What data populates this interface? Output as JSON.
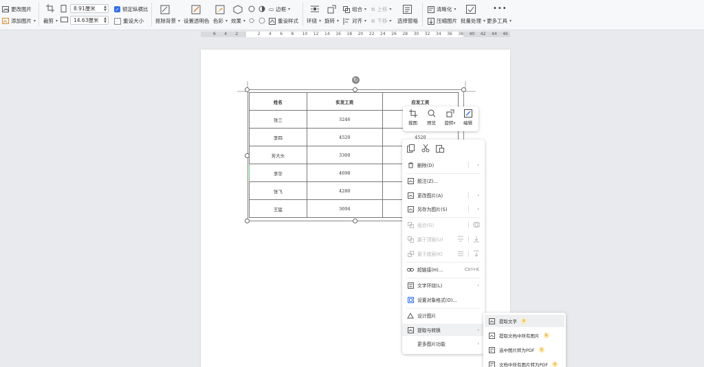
{
  "toolbar": {
    "change_picture": "更改图片",
    "add_picture": "添加图片",
    "crop": "裁剪",
    "height_value": "8.91厘米",
    "width_value": "14.63厘米",
    "lock_ratio": "锁定纵横比",
    "reset_size": "重设大小",
    "remove_bg": "抠除背景",
    "set_transparent": "设置透明色",
    "color": "色彩",
    "effects": "效果",
    "border": "边框",
    "reset_style": "重设样式",
    "wrap": "环绕",
    "rotate": "旋转",
    "group": "组合",
    "align": "对齐",
    "bring_forward": "上移",
    "send_backward": "下移",
    "selection_pane": "选择窗格",
    "clarity": "清晰化",
    "compress": "压缩图片",
    "batch": "批量处理",
    "more_tools": "更多工具"
  },
  "ruler": {
    "ticks": [
      "6",
      "4",
      "2",
      "",
      "2",
      "4",
      "6",
      "8",
      "10",
      "12",
      "14",
      "16",
      "18",
      "20",
      "22",
      "24",
      "26",
      "28",
      "30",
      "32",
      "34",
      "36",
      "38",
      "40",
      "42",
      "44",
      "46"
    ]
  },
  "table": {
    "headers": [
      "姓名",
      "实发工资",
      "应发工资"
    ],
    "rows": [
      [
        "张三",
        "3246",
        ""
      ],
      [
        "李四",
        "4520",
        "4520"
      ],
      [
        "芳大头",
        "3300",
        ""
      ],
      [
        "李华",
        "4698",
        ""
      ],
      [
        "张飞",
        "4280",
        ""
      ],
      [
        "王猛",
        "3694",
        ""
      ]
    ]
  },
  "mini_toolbar": {
    "crop": "裁图",
    "preview": "预览",
    "rotate": "旋转",
    "edit": "编辑"
  },
  "context_menu": {
    "delete": "删除(D)",
    "caption": "题注(Z)...",
    "change_picture": "更改图片(A)",
    "save_as_picture": "另存为图片(S)",
    "group": "组合(G)",
    "bring_to_front": "置于顶层(U)",
    "send_to_back": "置于底层(K)",
    "hyperlink": "超链接(H)...",
    "hyperlink_shortcut": "Ctrl+K",
    "text_wrap": "文字环绕(L)",
    "format_object": "设置对象格式(O)...",
    "design_picture": "设计图片",
    "extract_convert": "提取与转换",
    "more_functions": "更多图片功能"
  },
  "submenu": {
    "extract_text": "提取文字",
    "extract_all_images": "提取文档中所有图片",
    "selected_to_pdf": "选中图片转为PDF",
    "all_to_pdf": "文档中所有图片转为PDF"
  },
  "colors": {
    "accent": "#3070f0",
    "vip": "#d08c00"
  }
}
